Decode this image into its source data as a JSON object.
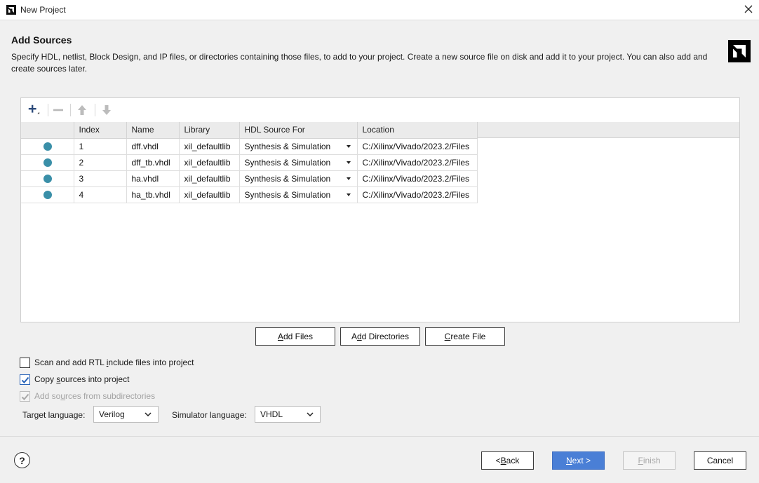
{
  "window": {
    "title": "New Project",
    "app_icon": "amd-logo-icon",
    "close_icon": "close-icon"
  },
  "header": {
    "title": "Add Sources",
    "description": "Specify HDL, netlist, Block Design, and IP files, or directories containing those files, to add to your project. Create a new source file on disk and add it to your project. You can also add and create sources later.",
    "logo": "amd-logo-icon"
  },
  "toolbar": {
    "add_icon": "plus-icon",
    "remove_icon": "minus-icon",
    "move_up_icon": "arrow-up-icon",
    "move_down_icon": "arrow-down-icon"
  },
  "table": {
    "columns": [
      "",
      "Index",
      "Name",
      "Library",
      "HDL Source For",
      "Location"
    ],
    "rows": [
      {
        "status_color": "#3a8fa8",
        "index": "1",
        "name": "dff.vhdl",
        "library": "xil_defaultlib",
        "hdl_source_for": "Synthesis & Simulation",
        "location": "C:/Xilinx/Vivado/2023.2/Files"
      },
      {
        "status_color": "#3a8fa8",
        "index": "2",
        "name": "dff_tb.vhdl",
        "library": "xil_defaultlib",
        "hdl_source_for": "Synthesis & Simulation",
        "location": "C:/Xilinx/Vivado/2023.2/Files"
      },
      {
        "status_color": "#3a8fa8",
        "index": "3",
        "name": "ha.vhdl",
        "library": "xil_defaultlib",
        "hdl_source_for": "Synthesis & Simulation",
        "location": "C:/Xilinx/Vivado/2023.2/Files"
      },
      {
        "status_color": "#3a8fa8",
        "index": "4",
        "name": "ha_tb.vhdl",
        "library": "xil_defaultlib",
        "hdl_source_for": "Synthesis & Simulation",
        "location": "C:/Xilinx/Vivado/2023.2/Files"
      }
    ]
  },
  "actions": {
    "add_files": {
      "mnemonic": "A",
      "rest": "dd Files"
    },
    "add_directories": {
      "pre": "A",
      "mnemonic": "d",
      "rest": "d Directories"
    },
    "create_file": {
      "mnemonic": "C",
      "rest": "reate File"
    }
  },
  "options": {
    "scan_rtl": {
      "pre": "Scan and add RTL ",
      "mnemonic": "i",
      "rest": "nclude files into project",
      "checked": false
    },
    "copy_sources": {
      "pre": "Copy ",
      "mnemonic": "s",
      "rest": "ources into project",
      "checked": true
    },
    "add_subdirs": {
      "pre": "Add so",
      "mnemonic": "u",
      "rest": "rces from subdirectories",
      "checked": true,
      "disabled": true
    }
  },
  "language": {
    "target_label": "Target language:",
    "target_value": "Verilog",
    "simulator_label": "Simulator language:",
    "simulator_value": "VHDL"
  },
  "footer": {
    "help": "?",
    "back": {
      "pre": "< ",
      "mnemonic": "B",
      "rest": "ack"
    },
    "next": {
      "mnemonic": "N",
      "rest": "ext >"
    },
    "finish": {
      "mnemonic": "F",
      "rest": "inish"
    },
    "cancel": "Cancel"
  },
  "colors": {
    "accent": "#4a7fd6",
    "status_dot": "#3a8fa8",
    "checkbox": "#2a64b8"
  }
}
